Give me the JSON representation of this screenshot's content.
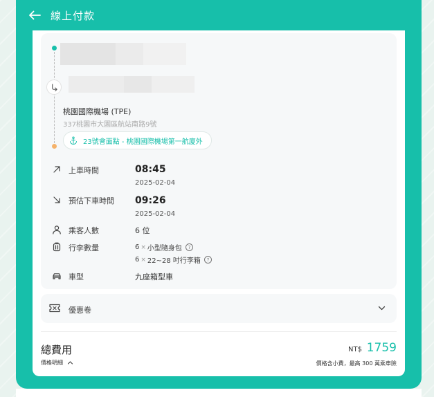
{
  "header": {
    "title": "線上付款",
    "back_icon": "arrow-left-icon"
  },
  "route": {
    "destination_name": "桃園國際機場 (TPE)",
    "destination_address": "337桃園市大園區航站南路9號",
    "meeting_point": "23號會面點 - 桃園國際機場第一航廈外"
  },
  "details": {
    "pickup_label": "上車時間",
    "pickup_time": "08:45",
    "pickup_date": "2025-02-04",
    "dropoff_label": "預估下車時間",
    "dropoff_time": "09:26",
    "dropoff_date": "2025-02-04",
    "passengers_label": "乘客人數",
    "passengers_value": "6 位",
    "luggage_label": "行李數量",
    "luggage": [
      {
        "count": "6",
        "sep": "×",
        "type": "小型隨身包"
      },
      {
        "count": "6",
        "sep": "×",
        "type": "22~28 吋行李箱"
      }
    ],
    "vehicle_label": "車型",
    "vehicle_value": "九座箱型車"
  },
  "coupon": {
    "label": "優惠卷"
  },
  "summary": {
    "total_label": "總費用",
    "price_detail_label": "價格明細",
    "currency": "NT$",
    "amount": "1759",
    "tax_note": "價格含小費，最高 300 萬乘車險"
  },
  "colors": {
    "accent": "#17bfaa",
    "end_dot": "#f5b26b"
  }
}
